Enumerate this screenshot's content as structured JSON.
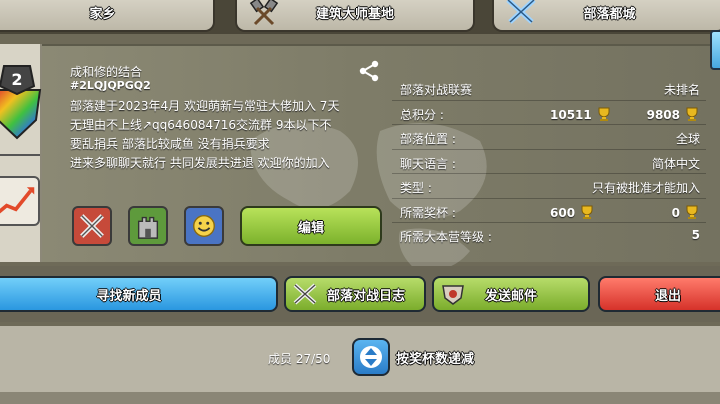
{
  "tabs": [
    {
      "label": "家乡",
      "icon": "home-icon"
    },
    {
      "label": "建筑大师基地",
      "icon": "builder-hammers-icon"
    },
    {
      "label": "部落都城",
      "icon": "capital-swords-icon"
    }
  ],
  "clan": {
    "level": "2",
    "name": "成和修的结合",
    "tag": "#2LQJQPGQ2",
    "description_lines": [
      "部落建于2023年4月 欢迎萌新与常驻大佬加入 7天",
      "无理由不上线↗qq646084716交流群 9本以下不",
      "要乱捐兵 部落比较咸鱼 没有捐兵要求",
      "进来多聊聊天就行 共同发展共进退 欢迎你的加入"
    ]
  },
  "info": {
    "war_league": {
      "label": "部落对战联赛",
      "value": "未排名"
    },
    "total_points": {
      "label": "总积分 :",
      "value1": "10511",
      "value2": "9808"
    },
    "location": {
      "label": "部落位置 :",
      "value": "全球"
    },
    "language": {
      "label": "聊天语言 :",
      "value": "简体中文"
    },
    "type": {
      "label": "类型 :",
      "value": "只有被批准才能加入"
    },
    "required_trophies": {
      "label": "所需奖杯 :",
      "value1": "600",
      "value2": "0"
    },
    "required_townhall": {
      "label": "所需大本营等级 :",
      "value": "5"
    }
  },
  "buttons": {
    "edit": "编辑",
    "find_members": "寻找新成员",
    "war_log": "部落对战日志",
    "send_mail": "发送邮件",
    "leave": "退出"
  },
  "members": {
    "label": "成员 27/50",
    "sort_label": "按奖杯数递减"
  },
  "colors": {
    "green_button": "#7cb22c",
    "blue_button": "#2a97e0",
    "red_button": "#d6322a",
    "trophy_gold": "#e8b820"
  }
}
